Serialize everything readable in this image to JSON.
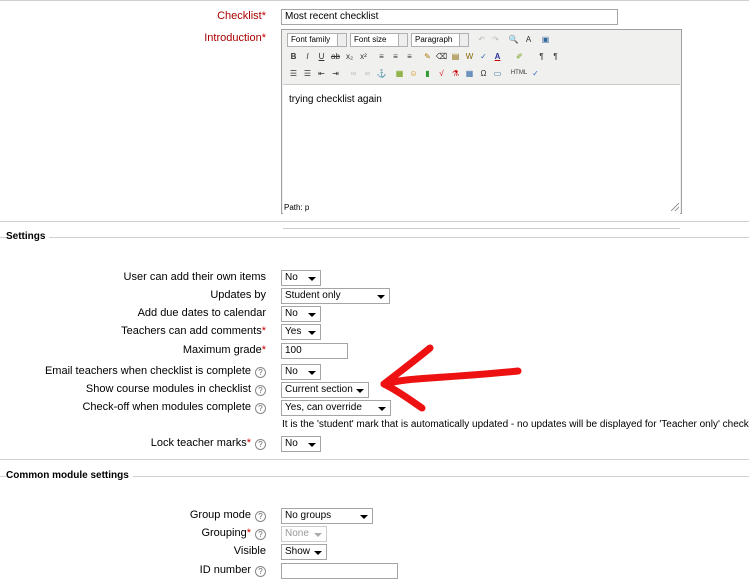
{
  "general": {
    "checklist_label": "Checklist",
    "checklist_value": "Most recent checklist",
    "intro_label": "Introduction",
    "required_mark": "*"
  },
  "editor": {
    "font_family": "Font family",
    "font_size": "Font size",
    "format": "Paragraph",
    "content": "trying checklist again",
    "path": "Path: p"
  },
  "settings": {
    "legend": "Settings",
    "rows": [
      {
        "label": "User can add their own items",
        "value": "No"
      },
      {
        "label": "Updates by",
        "value": "Student only"
      },
      {
        "label": "Add due dates to calendar",
        "value": "No"
      },
      {
        "label": "Teachers can add comments",
        "value": "Yes"
      },
      {
        "label": "Maximum grade",
        "value": "100"
      },
      {
        "label": "Email teachers when checklist is complete",
        "value": "No"
      },
      {
        "label": "Show course modules in checklist",
        "value": "Current section"
      },
      {
        "label": "Check-off when modules complete",
        "value": "Yes, can override"
      },
      {
        "label": "Lock teacher marks",
        "value": "No"
      }
    ],
    "note": "It is the 'student' mark that is automatically updated - no updates will be displayed for 'Teacher only' checklists"
  },
  "common": {
    "legend": "Common module settings",
    "rows": [
      {
        "label": "Group mode",
        "value": "No groups"
      },
      {
        "label": "Grouping",
        "value": "None"
      },
      {
        "label": "Visible",
        "value": "Show"
      },
      {
        "label": "ID number",
        "value": ""
      }
    ]
  },
  "colors": {
    "required_label": "#aa0000",
    "annotation_arrow": "#ee1111"
  }
}
